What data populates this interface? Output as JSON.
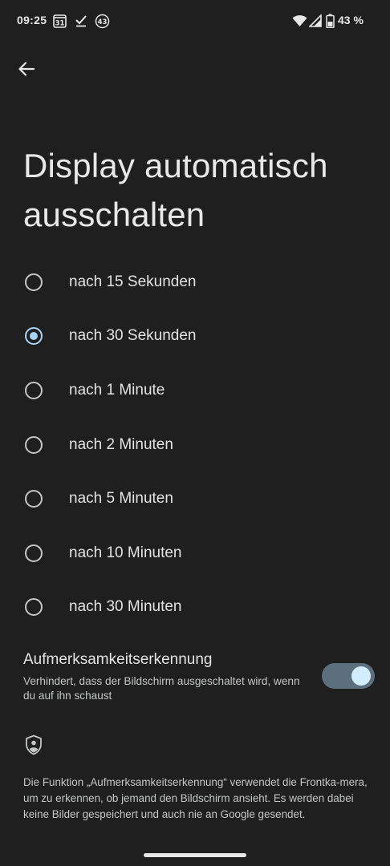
{
  "status_bar": {
    "time": "09:25",
    "calendar_day": "31",
    "badge_count": "43",
    "battery_percent": "43 %",
    "icons": [
      "calendar-icon",
      "checkmark-icon",
      "notification-badge-icon",
      "wifi-icon",
      "signal-icon",
      "battery-icon"
    ]
  },
  "header": {
    "back_icon": "arrow-back-icon",
    "title": "Display automatisch ausschalten"
  },
  "options": [
    {
      "label": "nach 15 Sekunden",
      "selected": false
    },
    {
      "label": "nach 30 Sekunden",
      "selected": true
    },
    {
      "label": "nach 1 Minute",
      "selected": false
    },
    {
      "label": "nach 2 Minuten",
      "selected": false
    },
    {
      "label": "nach 5 Minuten",
      "selected": false
    },
    {
      "label": "nach 10 Minuten",
      "selected": false
    },
    {
      "label": "nach 30 Minuten",
      "selected": false
    }
  ],
  "attention": {
    "title": "Aufmerksamkeitserkennung",
    "description": "Verhindert, dass der Bildschirm ausgeschaltet wird, wenn du auf ihn schaust",
    "toggle_on": true
  },
  "info": {
    "icon": "shield-person-icon",
    "text": "Die Funktion „Aufmerksamkeitserkennung“ verwendet die Frontka-mera, um zu erkennen, ob jemand den Bildschirm ansieht. Es werden dabei keine Bilder gespeichert und auch nie an Google gesendet."
  },
  "colors": {
    "background": "#1f1f1f",
    "accent": "#a8d4f7",
    "toggle_track": "#5c6f7c",
    "toggle_knob": "#d4ecff"
  }
}
